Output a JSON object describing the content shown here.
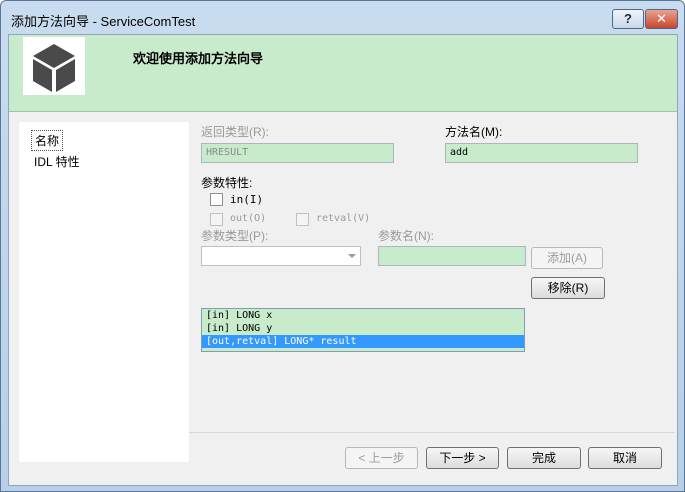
{
  "window": {
    "title": "添加方法向导 - ServiceComTest",
    "help_label": "?",
    "close_label": "✕"
  },
  "banner": {
    "title": "欢迎使用添加方法向导",
    "logo_icon": "cube-icon"
  },
  "sidebar": {
    "items": [
      {
        "label": "名称",
        "selected": true
      },
      {
        "label": "IDL 特性",
        "selected": false
      }
    ]
  },
  "form": {
    "return_type_label": "返回类型(R):",
    "return_type_value": "HRESULT",
    "method_name_label": "方法名(M):",
    "method_name_value": "add",
    "param_attrs_label": "参数特性:",
    "in_label": "in(I)",
    "out_label": "out(O)",
    "retval_label": "retval(V)",
    "param_type_label": "参数类型(P):",
    "param_type_value": "",
    "param_name_label": "参数名(N):",
    "param_name_value": "",
    "add_button": "添加(A)",
    "remove_button": "移除(R)",
    "params": [
      {
        "text": "[in] LONG x",
        "selected": false
      },
      {
        "text": "[in] LONG y",
        "selected": false
      },
      {
        "text": "[out,retval] LONG* result",
        "selected": true
      }
    ]
  },
  "footer": {
    "back": "< 上一步",
    "next": "下一步 >",
    "finish": "完成",
    "cancel": "取消"
  },
  "colors": {
    "banner_bg": "#c8ebcc",
    "selection": "#3399ff",
    "close_button": "#c8462e"
  }
}
